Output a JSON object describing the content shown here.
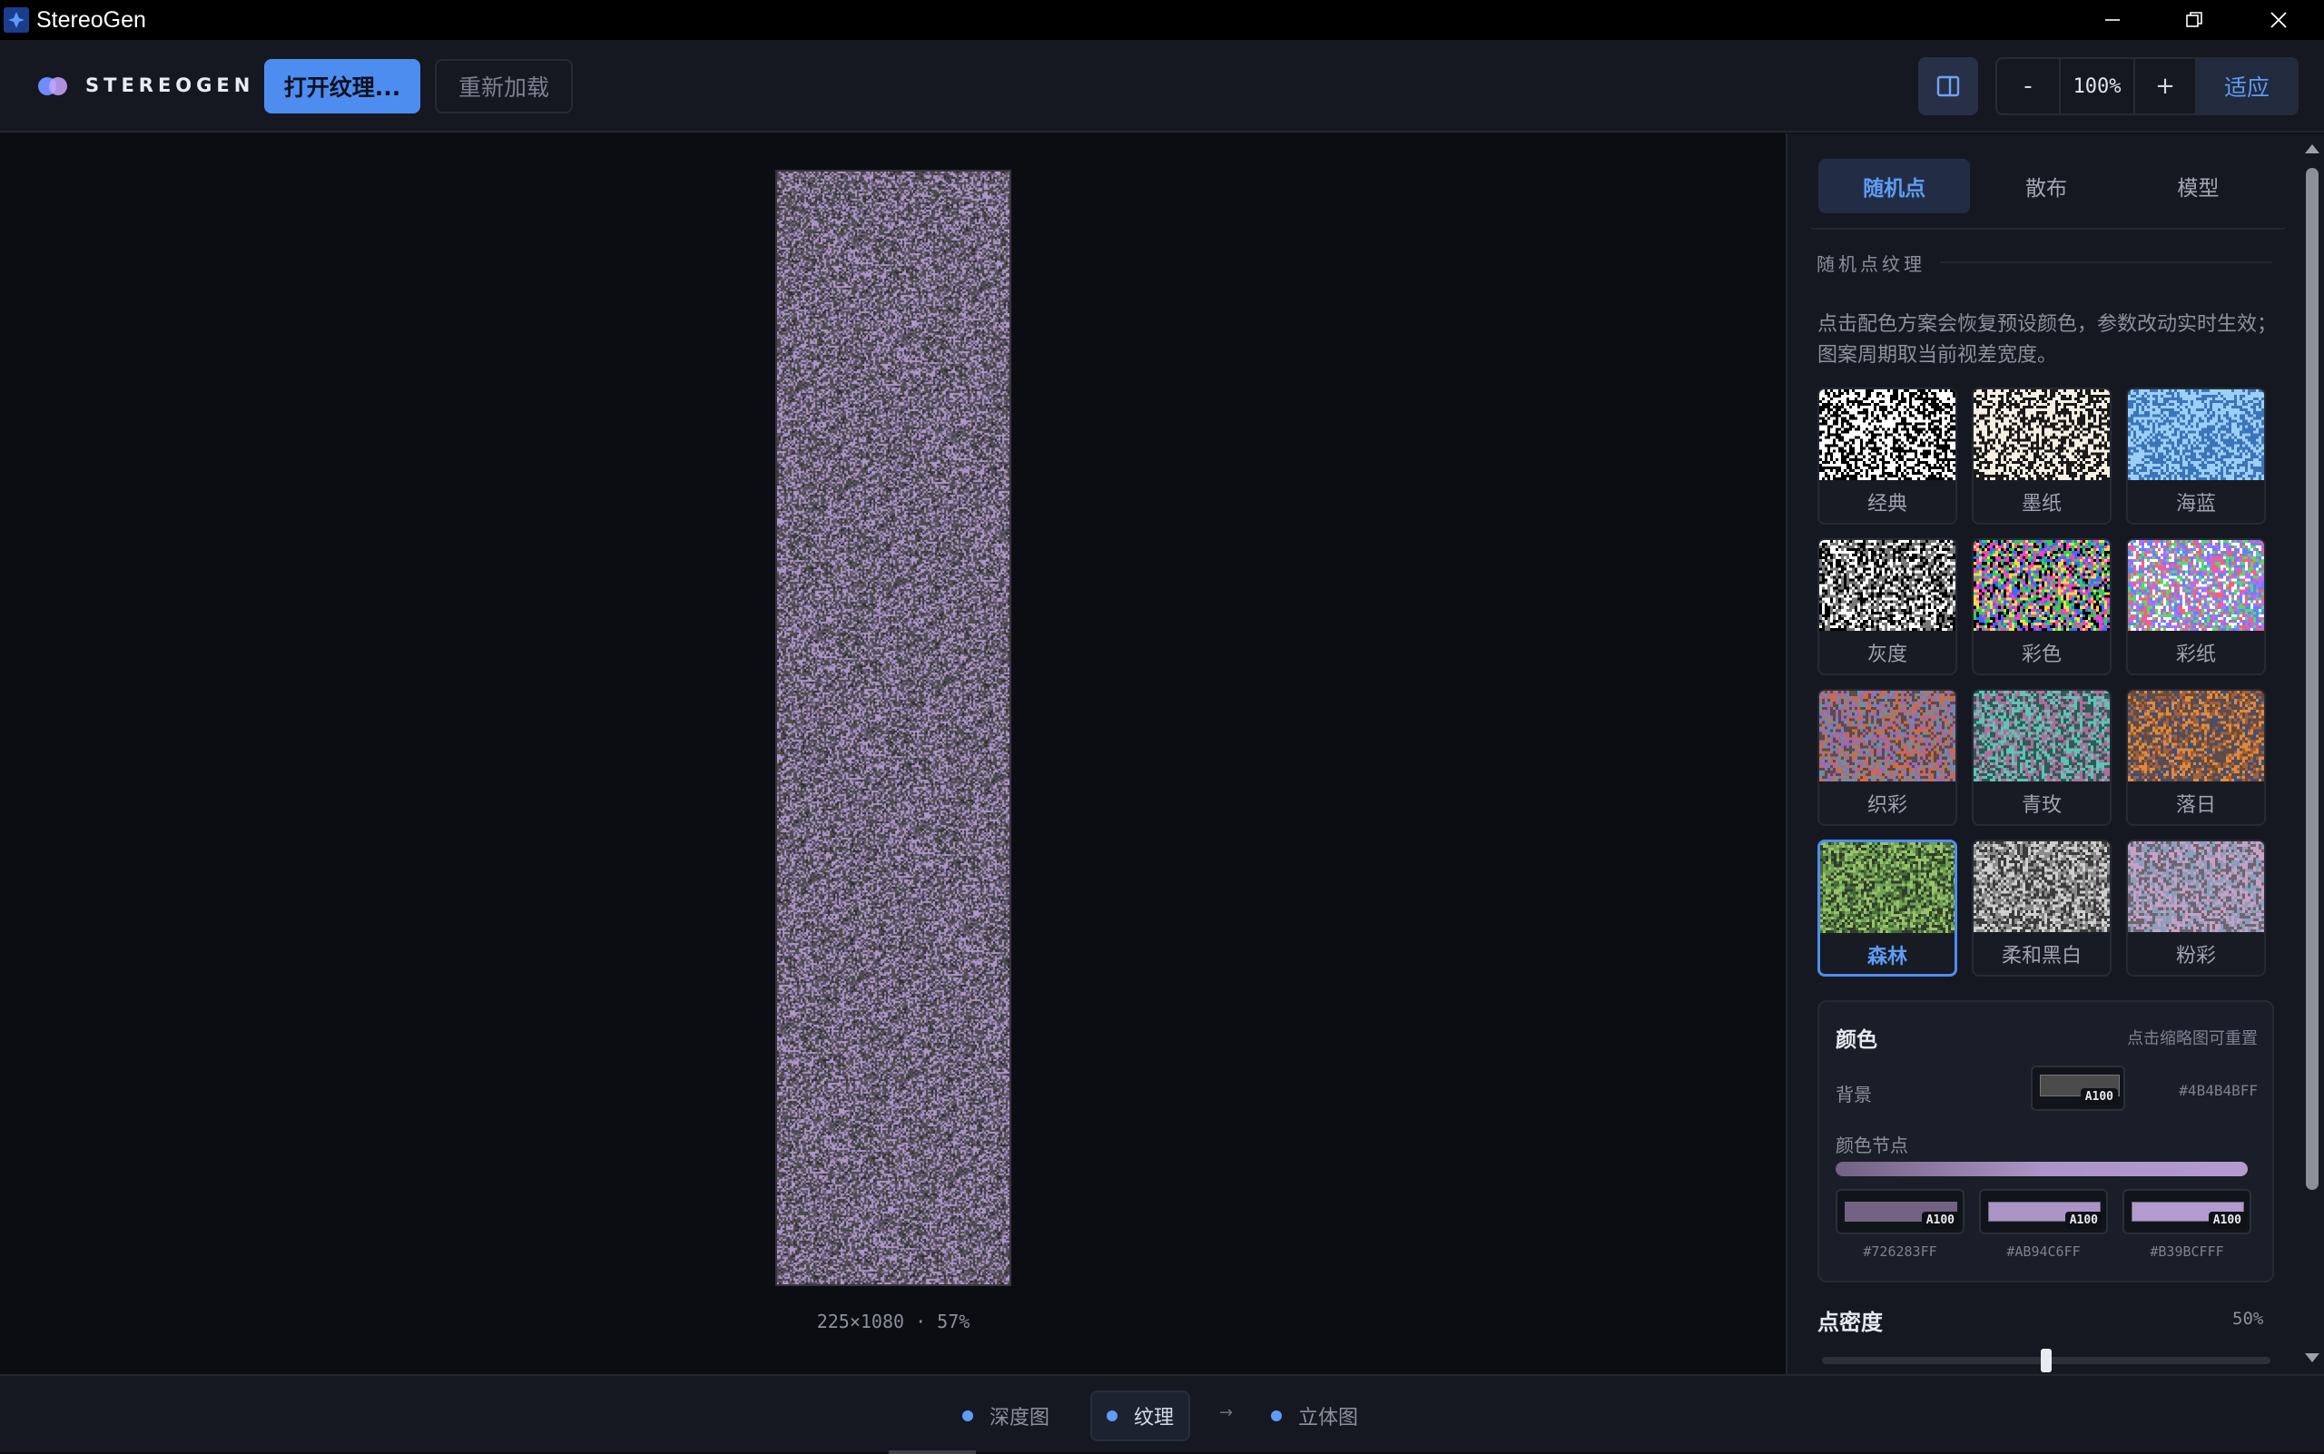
{
  "window": {
    "title": "StereoGen"
  },
  "toolbar": {
    "brand": "STEREOGEN",
    "open_label": "打开纹理...",
    "reload_label": "重新加载",
    "zoom_minus": "-",
    "zoom_value": "100%",
    "zoom_plus": "+",
    "fit_label": "适应"
  },
  "canvas": {
    "caption": "225×1080 · 57%"
  },
  "panel": {
    "tabs": [
      {
        "label": "随机点",
        "active": true
      },
      {
        "label": "散布",
        "active": false
      },
      {
        "label": "模型",
        "active": false
      }
    ],
    "section_title": "随机点纹理",
    "description": "点击配色方案会恢复预设颜色，参数改动实时生效；图案周期取当前视差宽度。",
    "presets": [
      {
        "label": "经典",
        "selected": false,
        "colors": [
          "#ffffff",
          "#000000"
        ]
      },
      {
        "label": "墨纸",
        "selected": false,
        "colors": [
          "#f4efe2",
          "#1a1a1a"
        ]
      },
      {
        "label": "海蓝",
        "selected": false,
        "colors": [
          "#9ccff5",
          "#3b74b8"
        ]
      },
      {
        "label": "灰度",
        "selected": false,
        "colors": [
          "#000000",
          "#ffffff",
          "#777777"
        ]
      },
      {
        "label": "彩色",
        "selected": false,
        "colors": [
          "#000000",
          "#ff3fbf",
          "#28d15b",
          "#3b6bff",
          "#ffd84a"
        ]
      },
      {
        "label": "彩纸",
        "selected": false,
        "colors": [
          "#ffffff",
          "#ff5c7a",
          "#58d86a",
          "#5a86ff",
          "#b46cff"
        ]
      },
      {
        "label": "织彩",
        "selected": false,
        "colors": [
          "#5d4a49",
          "#d06a44",
          "#6a8ea7",
          "#9a6ab3"
        ]
      },
      {
        "label": "青玫",
        "selected": false,
        "colors": [
          "#2f5b56",
          "#5ec4b5",
          "#b06c9a"
        ]
      },
      {
        "label": "落日",
        "selected": false,
        "colors": [
          "#6b4a36",
          "#e08a3c",
          "#3e4f7a",
          "#a25f3b"
        ]
      },
      {
        "label": "森林",
        "selected": true,
        "colors": [
          "#2f3d2b",
          "#6fa252",
          "#486a3a",
          "#9ac26a"
        ]
      },
      {
        "label": "柔和黑白",
        "selected": false,
        "colors": [
          "#3b3b3b",
          "#8a8a8a",
          "#cfcfcf"
        ]
      },
      {
        "label": "粉彩",
        "selected": false,
        "colors": [
          "#6e6570",
          "#c9a0c6",
          "#8aa0bd"
        ]
      }
    ],
    "color_card": {
      "title": "颜色",
      "hint": "点击缩略图可重置",
      "background_label": "背景",
      "background_hex": "#4B4B4BFF",
      "background_color": "#4b4b4b",
      "alpha_badge": "A100",
      "nodes_label": "颜色节点",
      "nodes": [
        {
          "hex": "#726283FF",
          "color": "#726283",
          "alpha": "A100"
        },
        {
          "hex": "#AB94C6FF",
          "color": "#ab94c6",
          "alpha": "A100"
        },
        {
          "hex": "#B39BCFFF",
          "color": "#b39bcf",
          "alpha": "A100"
        }
      ]
    },
    "density": {
      "label": "点密度",
      "value": "50%",
      "fraction": 0.5
    }
  },
  "bottombar": {
    "steps": [
      {
        "label": "深度图",
        "active": false
      },
      {
        "label": "纹理",
        "active": true
      },
      {
        "label": "立体图",
        "active": false
      }
    ],
    "arrow": "→"
  },
  "colors": {
    "accent": "#4e8df0",
    "accent_text": "#5e9cf5",
    "texture_palette": [
      "#4b4b4b",
      "#726283",
      "#ab94c6",
      "#b39bcf"
    ]
  }
}
